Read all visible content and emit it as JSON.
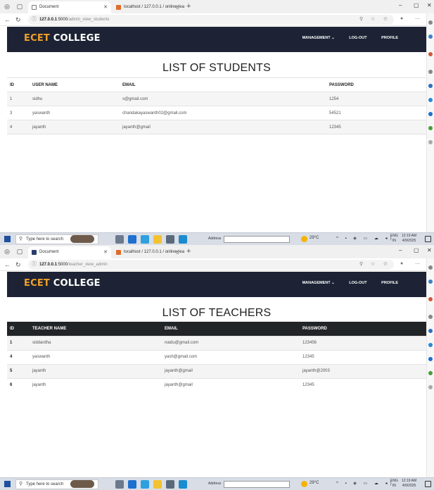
{
  "screens": [
    {
      "browser": {
        "tab_active_label": "Document",
        "tab_inactive_label": "localhost / 127.0.0.1 / online_lea",
        "url_host": "127.0.0.1",
        "url_port": ":5000",
        "url_path": "/admin_view_students"
      },
      "site": {
        "brand_accent": "ECET",
        "brand_rest": " COLLEGE",
        "nav": [
          "MANAGEMENT ⌄",
          "LOG-OUT",
          "PROFILE"
        ]
      },
      "title": "LIST OF STUDENTS",
      "columns": [
        "ID",
        "USER NAME",
        "EMAIL",
        "PASSWORD"
      ],
      "rows": [
        [
          "1",
          "sidhu",
          "s@gmail.com",
          "1254"
        ],
        [
          "3",
          "yaswanth",
          "chandakayaswanth02@gmail.com",
          "54521"
        ],
        [
          "4",
          "jayanth",
          "jayanth@gmail",
          "12345"
        ]
      ]
    },
    {
      "browser": {
        "tab_active_label": "Document",
        "tab_inactive_label": "localhost / 127.0.0.1 / online_lea",
        "url_host": "127.0.0.1",
        "url_port": ":5000",
        "url_path": "/teacher_view_admin"
      },
      "site": {
        "brand_accent": "ECET",
        "brand_rest": " COLLEGE",
        "nav": [
          "MANAGEMENT ⌄",
          "LOG-OUT",
          "PROFILE"
        ]
      },
      "title": "LIST OF TEACHERS",
      "columns": [
        "ID",
        "TEACHER NAME",
        "EMAIL",
        "PASSWORD"
      ],
      "rows": [
        [
          "1",
          "siddardha",
          "naidu@gmail.com",
          "123456"
        ],
        [
          "4",
          "yaswanth",
          "yash@gmail.com",
          "12345"
        ],
        [
          "5",
          "jayanth",
          "jayanth@gmail",
          "jayanth@2003"
        ],
        [
          "6",
          "jayanth",
          "jayanth@gmail",
          "12345"
        ]
      ]
    }
  ],
  "taskbar": {
    "search_placeholder": "Type here to search",
    "address_label": "Address",
    "temperature": "29°C",
    "lang_line1": "ENG",
    "lang_line2": "IN",
    "time": "12:19 AM",
    "date": "4/9/2025"
  },
  "colors": {
    "navbar_bg": "#1d2334",
    "brand_accent": "#f0a12a",
    "teacher_header_bg": "#222528"
  }
}
